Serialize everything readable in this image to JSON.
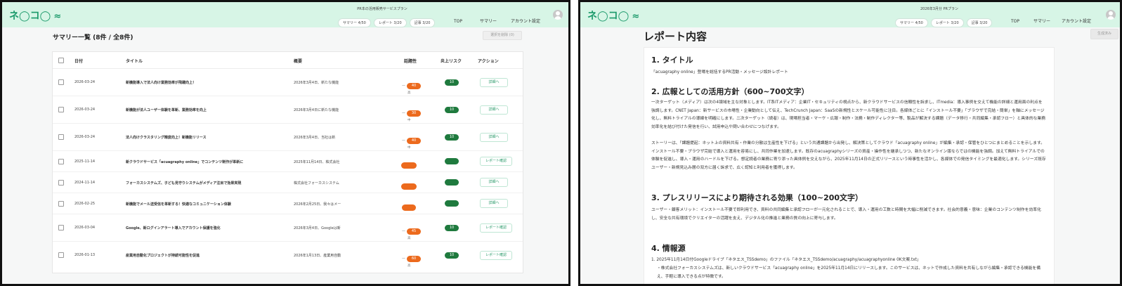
{
  "left": {
    "header": {
      "logo": "ネ◯コ◯",
      "logo_mark": "≈",
      "usage_title": "PR本の活用販売サービスプラン",
      "pills": [
        "サマリー 4/50",
        "レポート 3/20",
        "記事 3/20"
      ],
      "nav": [
        "TOP",
        "サマリー",
        "アカウント設定"
      ]
    },
    "title": "サマリー一覧 (8件 / 全8件)",
    "bulk_button": "選択を削除 (0)",
    "columns": [
      "日付",
      "タイトル",
      "概要",
      "話題性",
      "炎上リスク",
      "アクション"
    ],
    "rows": [
      {
        "date": "2026-03-24",
        "title": "新機能導入で法人向け業務効率が飛躍向上！",
        "summary": "2026年3月4日、新たな機能",
        "topic_lead": "—",
        "topic": "40",
        "topic_label": "高",
        "risk": "10",
        "action": "詳細へ"
      },
      {
        "date": "2026-03-24",
        "title": "新機能が法人ユーザー体験を革新、業務効率を向上",
        "summary": "2026年3月4日に新たな機能",
        "topic_lead": "—",
        "topic": "30",
        "topic_label": "中",
        "risk": "10",
        "action": "詳細へ"
      },
      {
        "date": "2026-03-24",
        "title": "法人向けクラスタリング精度向上！新機能リリース",
        "summary": "2026年3月4日、当社は新",
        "topic_lead": "—",
        "topic": "40",
        "topic_label": "中",
        "risk": "10",
        "action": "詳細へ"
      },
      {
        "date": "2025-11-14",
        "title": "新クラウドサービス「acuagraphy online」でコンテンツ制作が革新に",
        "summary": "2025年11月14日、株式会社",
        "topic_lead": "",
        "topic": "",
        "topic_label": "",
        "risk": "",
        "action": "レポート確認"
      },
      {
        "date": "2024-11-14",
        "title": "フォーカスシステムズ、子ども見守りシステムがメディア注目で効果実現",
        "summary": "株式会社フォーカスシステム",
        "topic_lead": "",
        "topic": "",
        "topic_label": "",
        "risk": "",
        "action": "詳細へ"
      },
      {
        "date": "2026-02-25",
        "title": "新機能でメール送受信を革新する！快適なコミュニケーション体験",
        "summary": "2026年2月25日、我々はメー",
        "topic_lead": "",
        "topic": "",
        "topic_label": "",
        "risk": "",
        "action": "詳細へ"
      },
      {
        "date": "2026-03-04",
        "title": "Google、新ログインアラート導入でアカウント保護を強化",
        "summary": "2026年3月4日、Googleは新",
        "topic_lead": "—",
        "topic": "45",
        "topic_label": "高",
        "risk": "10",
        "action": "レポート確認"
      },
      {
        "date": "2026-01-13",
        "title": "産業用自動化プロジェクトが持続可能性を促進",
        "summary": "2026年1月13日、産業用自動",
        "topic_lead": "—",
        "topic": "60",
        "topic_label": "高",
        "risk": "10",
        "action": "レポート確認"
      }
    ],
    "colors": {
      "topbar": "#d7f5e6",
      "topic_badge": "#ec6a1d",
      "risk_badge": "#1f7a3e",
      "accent": "#2a9a6a"
    }
  },
  "right": {
    "header": {
      "logo": "ネ◯コ◯",
      "logo_mark": "≈",
      "usage_title": "2026年3月分 PRプラン",
      "pills": [
        "サマリー 4/50",
        "レポート 3/20",
        "記事 3/20"
      ],
      "nav": [
        "TOP",
        "サマリー",
        "アカウント設定"
      ]
    },
    "title": "レポート内容",
    "button": "生成済み",
    "sections": [
      {
        "heading": "1. タイトル",
        "body": [
          "「acuagraphy online」登場を総括するPR活動・メッセージ設計レポート"
        ]
      },
      {
        "heading": "2. 広報としての活用方針（600~700文字）",
        "body": [
          "一次ターゲット（メディア）は次の4領域を主な対象とします。IT系ITメディア：企業IT・セキュリティの視点から、新クラウドサービスの信頼性を訴求し、ITmedia：導入事例を交えて機能の詳細と運用面の利点を強調します。CNET Japan：新サービスの市場性・企業動向として伝え、TechCrunch Japan：SaaSの新規性とスケール可能性に注目。各媒体ごとに「インストール不要」「ブラウザで完結・簡単」を軸にメッセージ化し、無料トライアルの導線を明確にします。二次ターゲット（読者）は、現場担当者・マーケ・広報・制作・法務・制作ディレクター等、製品が解決する課題（データ移行・共同編集・承認フロー）と具体的な業務効率化を結び付けた発信を行い、試用申込や問い合わせにつなげます。",
          "ストーリーは、「課題提起：ネット上の資料共有・作業の分散は生産性を下げる」という共通課題から出発し、解決策としてクラウド「acuagraphy online」が編集・承認・保管をひとつにまとめることを示します。インストール不要・ブラウザ完結で導入と運用を容易にし、共同作業を加速します。既存のacuagraphyシリーズの資産・操作性を継承しつつ、新たなオンライン版ならではの機能を強調。加えて無料トライアルでの体験を促進し、導入・運用のハードルを下げる。想定読者の業務に寄り添った具体例を交えながら、2025年11月14日の正式リリースという時事性を活かし、各媒体での発信タイミングを最適化します。シリーズ既存ユーザー・新規見込み層の双方に届く訴求で、広く認知と利用者を獲得します。"
        ]
      },
      {
        "heading": "3. プレスリリースにより期待される効果（100~200文字）",
        "body": [
          "ユーザー・顧客メリット：インストール不要で即利用でき、資料の共同編集と承認フローが一元化されることで、導入・運用の工数と時間を大幅に削減できます。社会的意義・意味：企業のコンテンツ制作を効率化し、安全な共有環境でクリエイターの活躍を支え、デジタル化の推進と業務の質の向上に寄与します。"
        ]
      },
      {
        "heading": "4. 情報源",
        "body": [
          "1. 2025年11月14日付Googleドライブ「ネタエス_TSSdemo」のファイル「ネタエス_TSSdemo/acuagraphy/acuagraphyonline 0K文案.txt」",
          "・株式会社フォーカスシステムズは、新しいクラウドサービス「acuagraphy online」を2025年11月14日にリリースします。このサービスは、ネットで作成した資料を共有しながら編集・承認できる機能を備え、手軽に導入できる点が特徴です。"
        ]
      }
    ]
  }
}
